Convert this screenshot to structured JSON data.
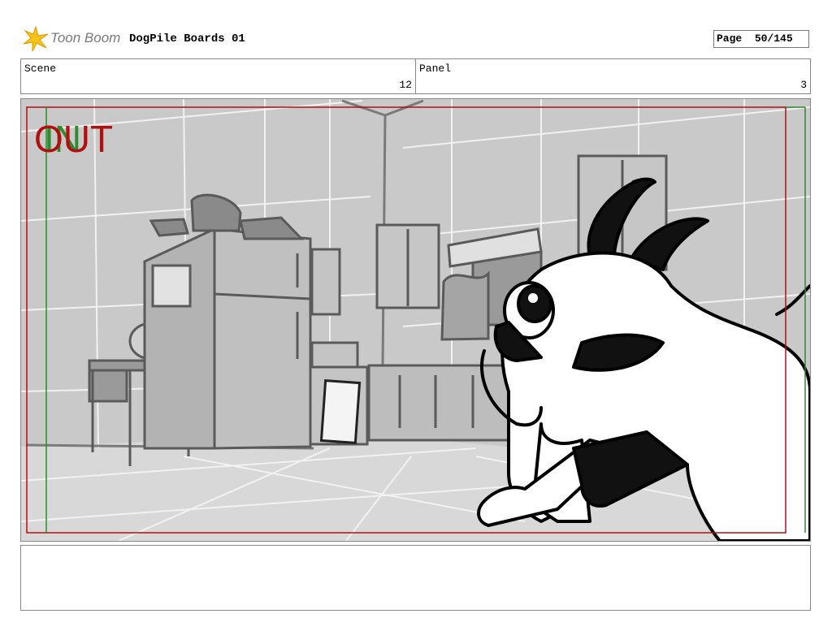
{
  "header": {
    "logo_text": "Toon Boom",
    "project_title": "DogPile Boards 01",
    "page_label": "Page",
    "page_value": "50/145"
  },
  "scene": {
    "label": "Scene",
    "value": "12"
  },
  "panel": {
    "label": "Panel",
    "value": "3"
  },
  "frame": {
    "out_marker": "OUT",
    "in_marker": "IN",
    "safe_frame_color": "#b01010",
    "field_guide_color": "#2e8b2e"
  },
  "notes": {
    "text": ""
  }
}
